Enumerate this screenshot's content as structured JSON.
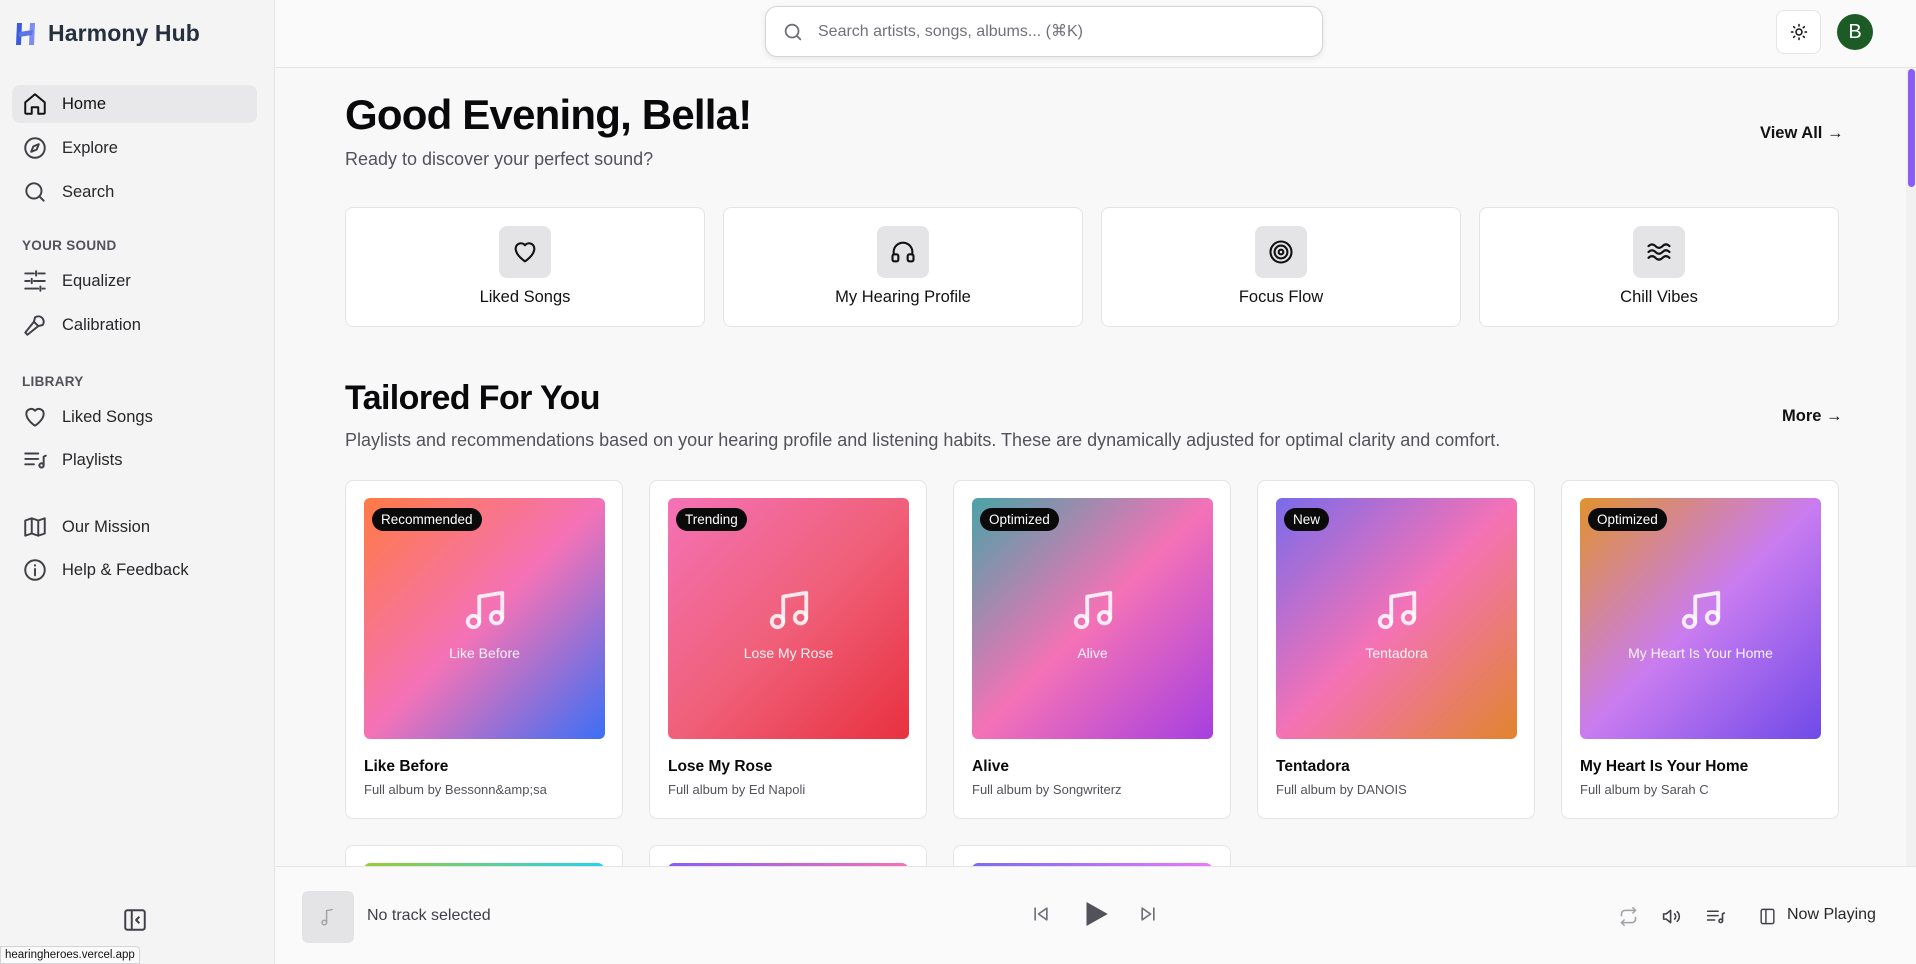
{
  "app": {
    "name": "Harmony Hub",
    "status_url": "hearingheroes.vercel.app"
  },
  "colors": {
    "accent": "#8b5cf6",
    "avatar_bg": "#1d5b26",
    "badge_bg": "#0a0a0a"
  },
  "sidebar": {
    "nav": [
      {
        "label": "Home",
        "icon": "home-icon",
        "active": true
      },
      {
        "label": "Explore",
        "icon": "compass-icon"
      },
      {
        "label": "Search",
        "icon": "search-icon"
      }
    ],
    "your_sound": {
      "title": "YOUR SOUND",
      "items": [
        {
          "label": "Equalizer",
          "icon": "sliders-icon"
        },
        {
          "label": "Calibration",
          "icon": "microphone-icon"
        }
      ]
    },
    "library": {
      "title": "LIBRARY",
      "items": [
        {
          "label": "Liked Songs",
          "icon": "heart-icon"
        },
        {
          "label": "Playlists",
          "icon": "playlist-icon"
        }
      ]
    },
    "extra": [
      {
        "label": "Our Mission",
        "icon": "map-icon"
      },
      {
        "label": "Help & Feedback",
        "icon": "info-icon"
      }
    ]
  },
  "header": {
    "search_placeholder": "Search artists, songs, albums... (⌘K)",
    "avatar_initial": "B"
  },
  "hero": {
    "greeting": "Good Evening, Bella!",
    "subtitle": "Ready to discover your perfect sound?",
    "view_all": "View All →"
  },
  "quick_access": [
    {
      "label": "Liked Songs",
      "icon": "heart-icon"
    },
    {
      "label": "My Hearing Profile",
      "icon": "headphones-icon"
    },
    {
      "label": "Focus Flow",
      "icon": "target-icon"
    },
    {
      "label": "Chill Vibes",
      "icon": "waves-icon"
    }
  ],
  "tailored": {
    "title": "Tailored For You",
    "description": "Playlists and recommendations based on your hearing profile and listening habits. These are dynamically adjusted for optimal clarity and comfort.",
    "more": "More →",
    "albums": [
      {
        "badge": "Recommended",
        "title": "Like Before",
        "subtitle": "Full album by Bessonn&amp;sa",
        "gradient": [
          "#ff7a45",
          "#f472b6",
          "#3b6ff5"
        ]
      },
      {
        "badge": "Trending",
        "title": "Lose My Rose",
        "subtitle": "Full album by Ed Napoli",
        "gradient": [
          "#f472b6",
          "#f0607a",
          "#e8313f"
        ]
      },
      {
        "badge": "Optimized",
        "title": "Alive",
        "subtitle": "Full album by Songwriterz",
        "gradient": [
          "#4aa3a7",
          "#f472b6",
          "#a63fe0"
        ]
      },
      {
        "badge": "New",
        "title": "Tentadora",
        "subtitle": "Full album by DANOIS",
        "gradient": [
          "#7a6bea",
          "#f472b6",
          "#e0852e"
        ]
      },
      {
        "badge": "Optimized",
        "title": "My Heart Is Your Home",
        "subtitle": "Full album by Sarah C",
        "gradient": [
          "#e0922e",
          "#c97cf0",
          "#6f4ae8"
        ]
      }
    ],
    "next_row_strips": [
      [
        "#9acd32",
        "#22d3ee"
      ],
      [
        "#8b5cf6",
        "#f472b6"
      ],
      [
        "#7c6cf0",
        "#e879f9"
      ]
    ]
  },
  "player": {
    "track_text": "No track selected",
    "now_playing_label": "Now Playing"
  }
}
